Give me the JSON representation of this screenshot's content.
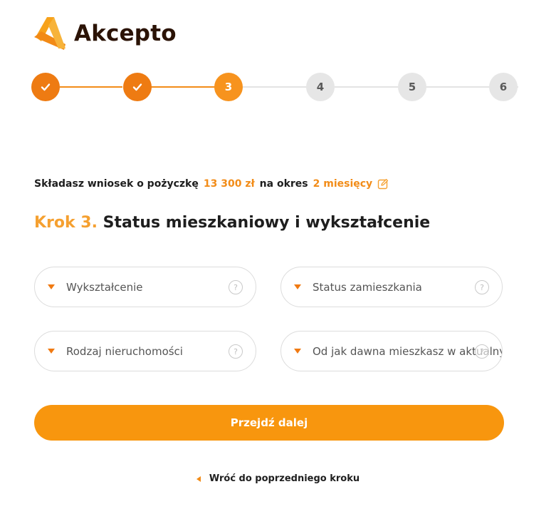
{
  "brand": {
    "name": "Akcepto",
    "accent_color": "#f28c18"
  },
  "stepper": {
    "steps": [
      {
        "label": "",
        "state": "done",
        "icon": "check-icon"
      },
      {
        "label": "",
        "state": "done",
        "icon": "check-icon"
      },
      {
        "label": "3",
        "state": "current"
      },
      {
        "label": "4",
        "state": "todo"
      },
      {
        "label": "5",
        "state": "todo"
      },
      {
        "label": "6",
        "state": "todo"
      }
    ]
  },
  "summary": {
    "prefix": "Składasz wniosek o pożyczkę",
    "amount": "13 300 zł",
    "middle": "na okres",
    "period": "2 miesięcy",
    "edit_icon": "edit-icon"
  },
  "title": {
    "step": "Krok 3.",
    "text": "Status mieszkaniowy i wykształcenie"
  },
  "fields": {
    "education": {
      "placeholder": "Wykształcenie"
    },
    "residence_status": {
      "placeholder": "Status zamieszkania"
    },
    "property_type": {
      "placeholder": "Rodzaj nieruchomości"
    },
    "residence_since": {
      "placeholder": "Od jak dawna mieszkasz w aktualnym"
    },
    "help_glyph": "?"
  },
  "actions": {
    "next_label": "Przejdź dalej",
    "back_label": "Wróć do poprzedniego kroku"
  }
}
